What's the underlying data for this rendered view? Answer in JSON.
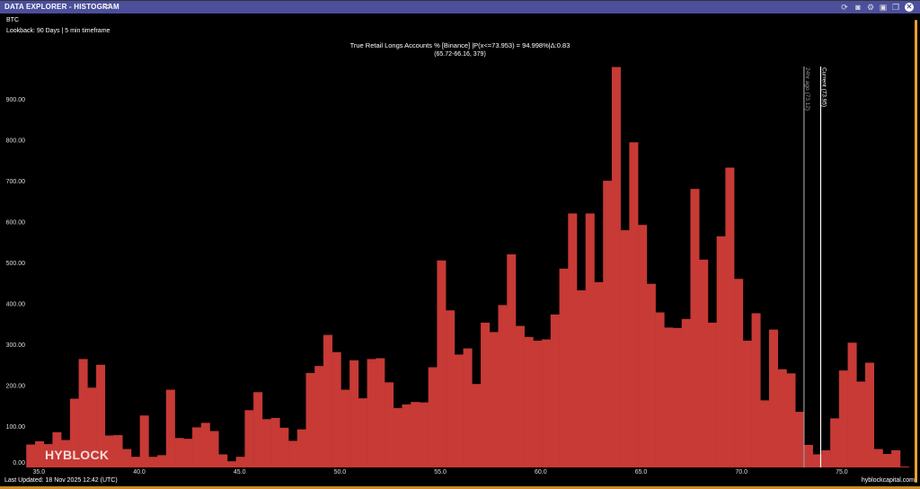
{
  "window": {
    "title": "DATA EXPLORER - HISTOGRAM",
    "icons": [
      "settings-sliders-icon",
      "refresh-icon",
      "camera-icon",
      "gear-icon",
      "save-icon",
      "copy-icon",
      "close-icon"
    ]
  },
  "info": {
    "asset": "BTC",
    "lookback": "Lookback: 90 Days | 5 min timeframe"
  },
  "footer": {
    "last_updated": "Last Updated: 18 Nov 2025 12:42 (UTC)",
    "site": "hyblockcapital.com"
  },
  "watermark": "HYBLOCK",
  "colors": {
    "bar": "#c73a35",
    "header": "#4b4f9c",
    "accent": "#f0a030",
    "background": "#000000"
  },
  "chart_data": {
    "type": "bar",
    "title": "True Retail Longs Accounts % [Binance] |P(x<=73.953) = 94.998%|Δ:0.83",
    "subtitle": "(65.72-66.16, 379)",
    "bin_start": 34.37,
    "bin_width": 0.4354,
    "values": [
      56,
      64,
      57,
      86,
      67,
      168,
      265,
      195,
      251,
      78,
      79,
      45,
      26,
      127,
      26,
      30,
      190,
      72,
      70,
      98,
      109,
      89,
      32,
      15,
      26,
      140,
      184,
      118,
      121,
      97,
      65,
      93,
      231,
      248,
      324,
      282,
      190,
      262,
      169,
      265,
      267,
      208,
      145,
      154,
      160,
      159,
      245,
      506,
      384,
      276,
      291,
      204,
      354,
      331,
      397,
      521,
      346,
      319,
      310,
      313,
      374,
      486,
      621,
      433,
      621,
      453,
      701,
      979,
      580,
      795,
      593,
      449,
      379,
      342,
      341,
      363,
      681,
      508,
      354,
      565,
      733,
      461,
      310,
      377,
      164,
      337,
      240,
      230,
      136,
      55,
      32,
      42,
      120,
      237,
      305,
      210,
      256,
      45,
      33,
      42,
      2
    ],
    "xlim": [
      34.0,
      78.5
    ],
    "ylim": [
      0,
      990
    ],
    "x_ticks": [
      "35.0",
      "40.0",
      "45.0",
      "50.0",
      "55.0",
      "60.0",
      "65.0",
      "70.0",
      "75.0"
    ],
    "x_tick_values": [
      35,
      40,
      45,
      50,
      55,
      60,
      65,
      70,
      75
    ],
    "y_ticks": [
      "0.00",
      "100.00",
      "200.00",
      "300.00",
      "400.00",
      "500.00",
      "600.00",
      "700.00",
      "800.00",
      "900.00"
    ],
    "y_tick_values": [
      0,
      100,
      200,
      300,
      400,
      500,
      600,
      700,
      800,
      900
    ],
    "grid": false,
    "markers": [
      {
        "label": "24hr ago (73.12)",
        "x": 73.12,
        "color": "#9a9a9a"
      },
      {
        "label": "Current (73.95)",
        "x": 73.95,
        "color": "#ffffff"
      }
    ]
  }
}
